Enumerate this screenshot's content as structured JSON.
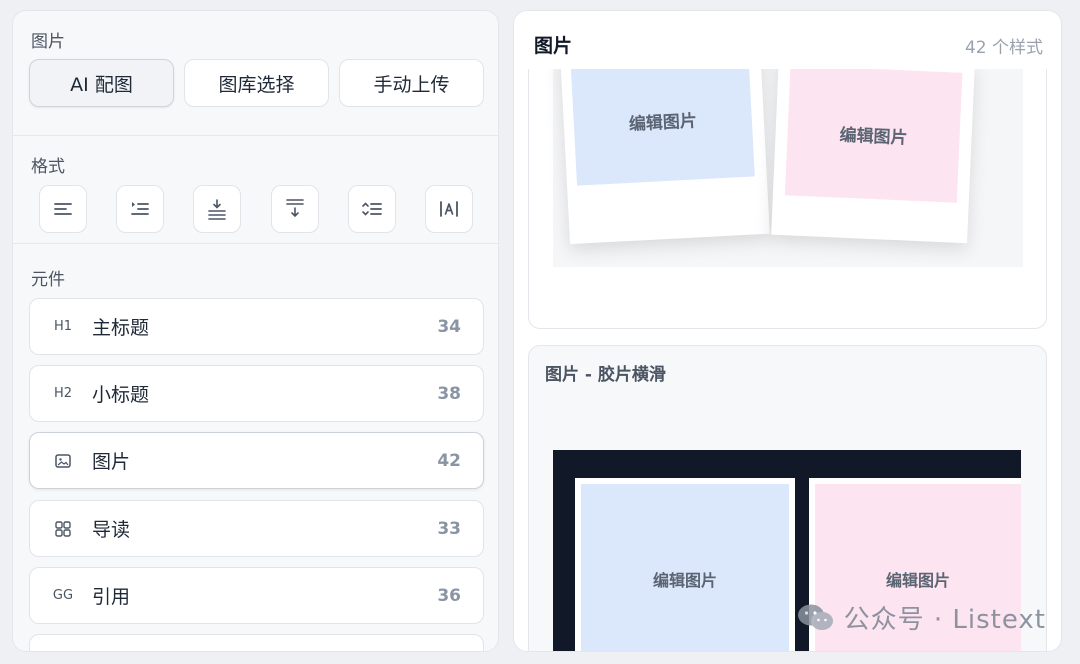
{
  "left": {
    "image_section_title": "图片",
    "source_buttons": [
      {
        "label": "AI 配图",
        "active": true
      },
      {
        "label": "图库选择",
        "active": false
      },
      {
        "label": "手动上传",
        "active": false
      }
    ],
    "format_section_title": "格式",
    "format_buttons": [
      {
        "icon": "align-left-icon"
      },
      {
        "icon": "indent-icon"
      },
      {
        "icon": "spacing-top-icon"
      },
      {
        "icon": "spacing-bottom-icon"
      },
      {
        "icon": "line-height-icon"
      },
      {
        "icon": "text-width-icon"
      }
    ],
    "components_section_title": "元件",
    "components": [
      {
        "icon_text": "H1",
        "label": "主标题",
        "count": "34"
      },
      {
        "icon_text": "H2",
        "label": "小标题",
        "count": "38"
      },
      {
        "icon_text": "",
        "label": "图片",
        "count": "42",
        "active": true
      },
      {
        "icon_text": "",
        "label": "导读",
        "count": "33"
      },
      {
        "icon_text": "GG",
        "label": "引用",
        "count": "36"
      }
    ]
  },
  "right": {
    "title": "图片",
    "count": "42 个样式",
    "card1": {
      "photo_labels": [
        "编辑图片",
        "编辑图片"
      ],
      "colors": {
        "blue": "#dbe7fb",
        "pink": "#fce4f0"
      }
    },
    "card2": {
      "title": "图片 - 胶片横滑",
      "photo_labels": [
        "编辑图片",
        "编辑图片"
      ]
    }
  },
  "watermark": "公众号 · Listext"
}
